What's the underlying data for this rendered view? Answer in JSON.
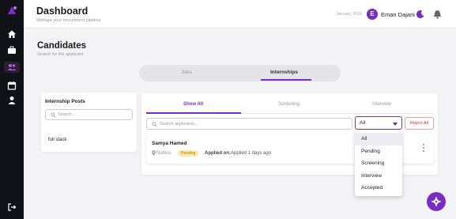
{
  "sidebar": {
    "items": [
      {
        "icon": "home-icon"
      },
      {
        "icon": "briefcase-icon"
      },
      {
        "icon": "users-icon",
        "active": true
      },
      {
        "icon": "calendar-icon"
      },
      {
        "icon": "user-icon"
      }
    ],
    "logout_icon": "logout-icon"
  },
  "header": {
    "title": "Dashboard",
    "subtitle": "Manage your recruitment pipeline",
    "date": "January 2026",
    "avatar_initial": "E",
    "user_name": "Eman Dajani"
  },
  "page": {
    "title": "Candidates",
    "subtitle": "Search for the applicant"
  },
  "switch": {
    "jobs": "Jobs",
    "internships": "Internships",
    "active": "internships"
  },
  "posts": {
    "title": "Internship Posts",
    "search_placeholder": "Search...",
    "items": [
      "full stack"
    ]
  },
  "main": {
    "tabs": {
      "show_all": "Show All",
      "screening": "Screening",
      "interview": "Interview"
    },
    "search_placeholder": "Search applicants...",
    "filter_value": "All",
    "reject_all": "Reject All",
    "applicant": {
      "name": "Samya Hamed",
      "location": "Nablus",
      "status": "Pending",
      "applied_label": "Applied on:",
      "applied_value": "Applied 1 days ago"
    }
  },
  "dropdown": {
    "options": [
      "All",
      "Pending",
      "Screening",
      "Interview",
      "Accepted"
    ],
    "selected": "All"
  },
  "colors": {
    "accent": "#7a2cc7",
    "sidebar_bg": "#111118",
    "pending_badge_bg": "#fde9b0",
    "reject_text": "#c0392b"
  }
}
